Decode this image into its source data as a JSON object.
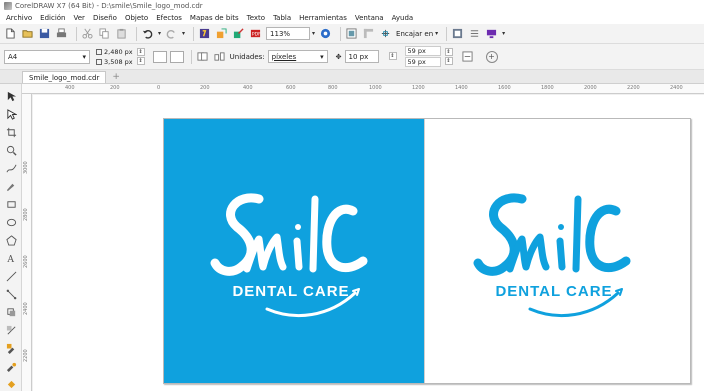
{
  "window": {
    "title": "CorelDRAW X7 (64 Bit) - D:\\smile\\Smile_logo_mod.cdr"
  },
  "menu": [
    {
      "key": "archivo",
      "label": "Archivo"
    },
    {
      "key": "edicion",
      "label": "Edición"
    },
    {
      "key": "ver",
      "label": "Ver"
    },
    {
      "key": "diseno",
      "label": "Diseño"
    },
    {
      "key": "objeto",
      "label": "Objeto"
    },
    {
      "key": "efectos",
      "label": "Efectos"
    },
    {
      "key": "mapas",
      "label": "Mapas de bits"
    },
    {
      "key": "texto",
      "label": "Texto"
    },
    {
      "key": "tabla",
      "label": "Tabla"
    },
    {
      "key": "herramientas",
      "label": "Herramientas"
    },
    {
      "key": "ventana",
      "label": "Ventana"
    },
    {
      "key": "ayuda",
      "label": "Ayuda"
    }
  ],
  "toolbar": {
    "zoom": "113%",
    "fit_label": "Encajar en"
  },
  "property_bar": {
    "page_size": "A4",
    "width": "2,480 px",
    "height": "3,508 px",
    "units_label": "Unidades:",
    "units_value": "píxeles",
    "nudge": "10 px",
    "dup_x": "59 px",
    "dup_y": "59 px"
  },
  "document_tab": {
    "label": "Smile_logo_mod.cdr"
  },
  "ruler": {
    "h_ticks": [
      "400",
      "200",
      "0",
      "200",
      "400",
      "600",
      "800",
      "1000",
      "1200",
      "1400",
      "1600",
      "1800",
      "2000",
      "2200",
      "2400"
    ],
    "v_ticks": [
      "3000",
      "2800",
      "2600",
      "2400",
      "2200"
    ]
  },
  "logo": {
    "word": "Smile",
    "tagline": "DENTAL CARE",
    "colors": {
      "brand_blue": "#0fa1de",
      "white": "#ffffff"
    }
  }
}
